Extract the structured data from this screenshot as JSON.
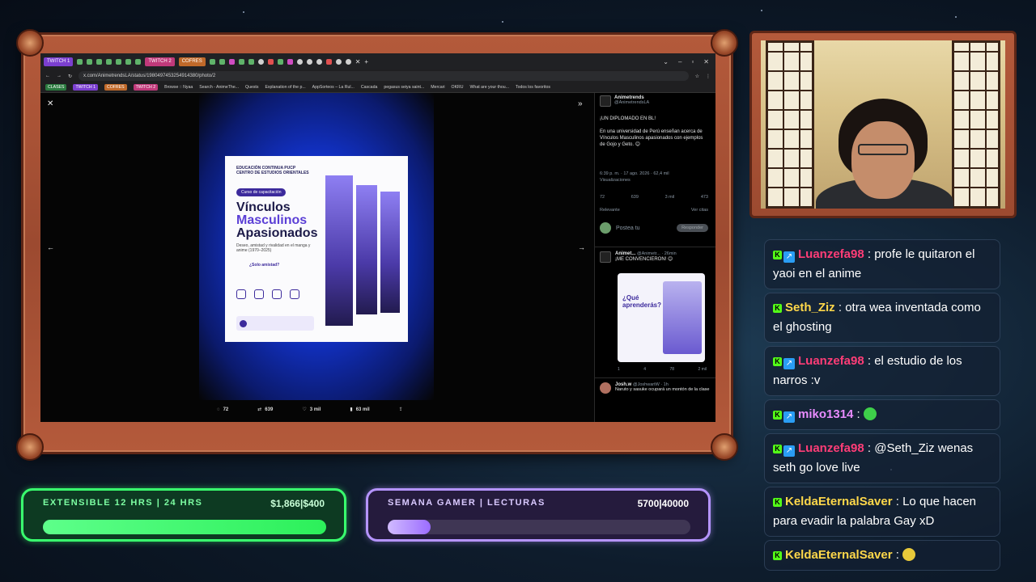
{
  "browser": {
    "tabs": [
      "TWITCH 1",
      "TWITCH 2",
      "COFRES"
    ],
    "url": "x.com/AnimetrendsLA/status/1980497453254914380/photo/2",
    "bookmarks": [
      "CLASES",
      "TWITCH 1",
      "COFRES",
      "TWITCH 2",
      "Browse :: Nyaa",
      "Search - AnimeThe...",
      "Quests",
      "Explanation of the p...",
      "AppSorteos – La Rul...",
      "Cascada",
      "pegasus seiya saint...",
      "Mercari",
      "OKRU",
      "What are your thou...",
      "Todos los favoritos"
    ]
  },
  "viewer": {
    "poster": {
      "org": "EDUCACIÓN CONTINUA PUCP",
      "org2": "CENTRO DE ESTUDIOS ORIENTALES",
      "pill": "Curso de capacitación",
      "title_1": "Vínculos",
      "title_2": "Masculinos",
      "title_3": "Apasionados",
      "subtitle": "Deseo, amistad y rivalidad en el manga y anime (1970–2025)",
      "question": "¿Solo amistad?"
    },
    "stats": {
      "replies": "72",
      "reposts": "639",
      "likes": "3 mil",
      "views": "63 mil"
    }
  },
  "tweet": {
    "name": "Animetrends",
    "handle": "@AnimetrendsLA",
    "headline": "¡UN DIPLOMADO EN BL!",
    "body": "En una universidad de Perú enseñan acerca de Vínculos Masculinos apasionados con ejemplos de Gojo y Geto. 😊",
    "time": "6:39 p. m. · 17 ago. 2026 · 62,4 mil",
    "views_label": "Visualizaciones",
    "actions": [
      "72",
      "639",
      "3 mil",
      "473"
    ],
    "relevant": "Relevante",
    "see_quotes": "Ver citas",
    "reply_placeholder": "Postea tu",
    "reply_button": "Responder",
    "reply2_name": "Animet...",
    "reply2_handle": "@Animetr... · 26min",
    "reply2_text": "¡ME CONVENCIERON! 😊",
    "reply2_image_title": "¿Qué aprenderás?",
    "reply2_stats": [
      "1",
      "4",
      "78",
      "2 mil"
    ],
    "reply3_name": "Josh.w",
    "reply3_handle": "@JoshwartW · 1h",
    "reply3_text": "Naruto y sasuke ocupará un montón de la clase"
  },
  "chat": [
    {
      "user": "Luanzefa98",
      "color": "#ff3d77",
      "badge2": true,
      "text": "profe le quitaron el yaoi en el anime"
    },
    {
      "user": "Seth_Ziz",
      "color": "#ffd84a",
      "badge2": false,
      "text": "otra wea inventada como el ghosting"
    },
    {
      "user": "Luanzefa98",
      "color": "#ff3d77",
      "badge2": true,
      "text": "el estudio de los narros :v"
    },
    {
      "user": "miko1314",
      "color": "#e98cff",
      "badge2": true,
      "text": "",
      "emote": "green-blob"
    },
    {
      "user": "Luanzefa98",
      "color": "#ff3d77",
      "badge2": true,
      "text": "@Seth_Ziz wenas seth go love live"
    },
    {
      "user": "KeldaEternalSaver",
      "color": "#ffd84a",
      "badge2": false,
      "text": "Lo que hacen para evadir la palabra Gay xD"
    },
    {
      "user": "KeldaEternalSaver",
      "color": "#ffd84a",
      "badge2": false,
      "text": "",
      "emote": "yellow-face"
    }
  ],
  "goals": {
    "green": {
      "title": "EXTENSIBLE 12 HRS | 24 HRS",
      "amount": "$1,866|$400",
      "progress": 1.0,
      "color": "#39ff6e"
    },
    "purple": {
      "title": "SEMANA GAMER | LECTURAS",
      "amount": "5700|40000",
      "progress": 0.143,
      "color": "#b594ff"
    }
  }
}
